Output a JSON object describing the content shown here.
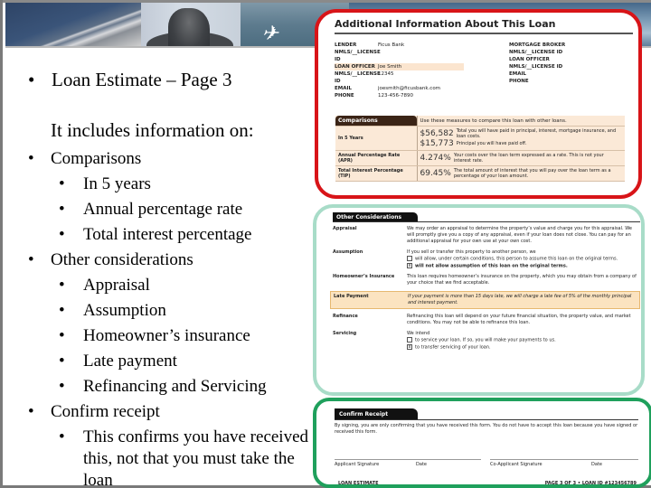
{
  "slide": {
    "heading_bullet": "•",
    "heading": "Loan Estimate – Page 3",
    "intro": "It includes information on:",
    "outline": [
      {
        "level": 1,
        "text": "Comparisons"
      },
      {
        "level": 2,
        "text": "In 5 years"
      },
      {
        "level": 2,
        "text": "Annual percentage rate"
      },
      {
        "level": 2,
        "text": "Total interest percentage"
      },
      {
        "level": 1,
        "text": "Other considerations"
      },
      {
        "level": 2,
        "text": "Appraisal"
      },
      {
        "level": 2,
        "text": "Assumption"
      },
      {
        "level": 2,
        "text": "Homeowner’s insurance"
      },
      {
        "level": 2,
        "text": "Late payment"
      },
      {
        "level": 2,
        "text": "Refinancing and Servicing"
      },
      {
        "level": 1,
        "text": "Confirm receipt"
      },
      {
        "level": 2,
        "text": "This confirms you have received this, not that you must take the loan"
      }
    ],
    "bullet": "•"
  },
  "additional_info": {
    "title": "Additional Information About This Loan",
    "lender": [
      {
        "key": "Lender",
        "value": "Ficus Bank"
      },
      {
        "key": "NMLS/__License ID",
        "value": ""
      },
      {
        "key": "Loan Officer",
        "value": "Joe Smith",
        "highlight": true
      },
      {
        "key": "NMLS/__License ID",
        "value": "12345"
      },
      {
        "key": "Email",
        "value": "joesmith@ficusbank.com"
      },
      {
        "key": "Phone",
        "value": "123-456-7890"
      }
    ],
    "broker": [
      {
        "key": "Mortgage Broker",
        "value": ""
      },
      {
        "key": "NMLS/__License ID",
        "value": ""
      },
      {
        "key": "Loan Officer",
        "value": ""
      },
      {
        "key": "NMLS/__License ID",
        "value": ""
      },
      {
        "key": "Email",
        "value": ""
      },
      {
        "key": "Phone",
        "value": ""
      }
    ]
  },
  "comparisons": {
    "header": "Comparisons",
    "header_desc": "Use these measures to compare this loan with other loans.",
    "rows": [
      {
        "label": "In 5 Years",
        "lines": [
          {
            "amount": "$56,582",
            "desc": "Total you will have paid in principal, interest, mortgage insurance, and loan costs."
          },
          {
            "amount": "$15,773",
            "desc": "Principal you will have paid off."
          }
        ]
      },
      {
        "label": "Annual Percentage Rate (APR)",
        "lines": [
          {
            "amount": "4.274%",
            "desc": "Your costs over the loan term expressed as a rate. This is not your interest rate."
          }
        ]
      },
      {
        "label": "Total Interest Percentage (TIP)",
        "lines": [
          {
            "amount": "69.45%",
            "desc": "The total amount of interest that you will pay over the loan term as a percentage of your loan amount."
          }
        ]
      }
    ]
  },
  "other_considerations": {
    "header": "Other Considerations",
    "appraisal": {
      "label": "Appraisal",
      "text": "We may order an appraisal to determine the property’s value and charge you for this appraisal. We will promptly give you a copy of any appraisal, even if your loan does not close. You can pay for an additional appraisal for your own use at your own cost."
    },
    "assumption": {
      "label": "Assumption",
      "intro": "If you sell or transfer this property to another person, we",
      "opt1": "will allow, under certain conditions, this person to assume this loan on the original terms.",
      "opt1_checked": "",
      "opt2": "will not allow assumption of this loan on the original terms.",
      "opt2_checked": "x"
    },
    "insurance": {
      "label": "Homeowner’s Insurance",
      "text": "This loan requires homeowner’s insurance on the property, which you may obtain from a company of your choice that we find acceptable."
    },
    "late": {
      "label": "Late Payment",
      "text": "If your payment is more than 15 days late, we will charge a late fee of 5% of the monthly principal and interest payment."
    },
    "refinance": {
      "label": "Refinance",
      "text": "Refinancing this loan will depend on your future financial situation, the property value, and market conditions. You may not be able to refinance this loan."
    },
    "servicing": {
      "label": "Servicing",
      "intro": "We intend",
      "opt1": "to service your loan. If so, you will make your payments to us.",
      "opt1_checked": "",
      "opt2": "to transfer servicing of your loan.",
      "opt2_checked": "x"
    }
  },
  "confirm_receipt": {
    "header": "Confirm Receipt",
    "text": "By signing, you are only confirming that you have received this form. You do not have to accept this loan because you have signed or received this form.",
    "applicant_sig": "Applicant Signature",
    "date1": "Date",
    "coapplicant_sig": "Co-Applicant Signature",
    "date2": "Date",
    "footer_left": "LOAN ESTIMATE",
    "footer_right": "PAGE 3 OF 3 • LOAN ID #123456789"
  }
}
